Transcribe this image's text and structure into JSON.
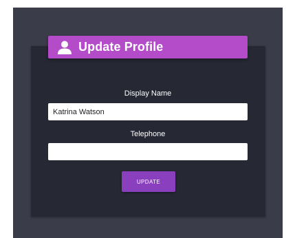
{
  "profile_form": {
    "title": "Update Profile",
    "header_icon": "user-icon",
    "display_name": {
      "label": "Display Name",
      "value": "Katrina Watson",
      "placeholder": ""
    },
    "telephone": {
      "label": "Telephone",
      "value": "",
      "placeholder": ""
    },
    "update_button_label": "UPDATE"
  },
  "colors": {
    "page_background": "#ffffff",
    "frame_background": "#3a3c49",
    "card_background": "#262834",
    "header_background": "#b44bc9",
    "button_background": "#8a3fbf",
    "text_light": "#ffffff"
  }
}
